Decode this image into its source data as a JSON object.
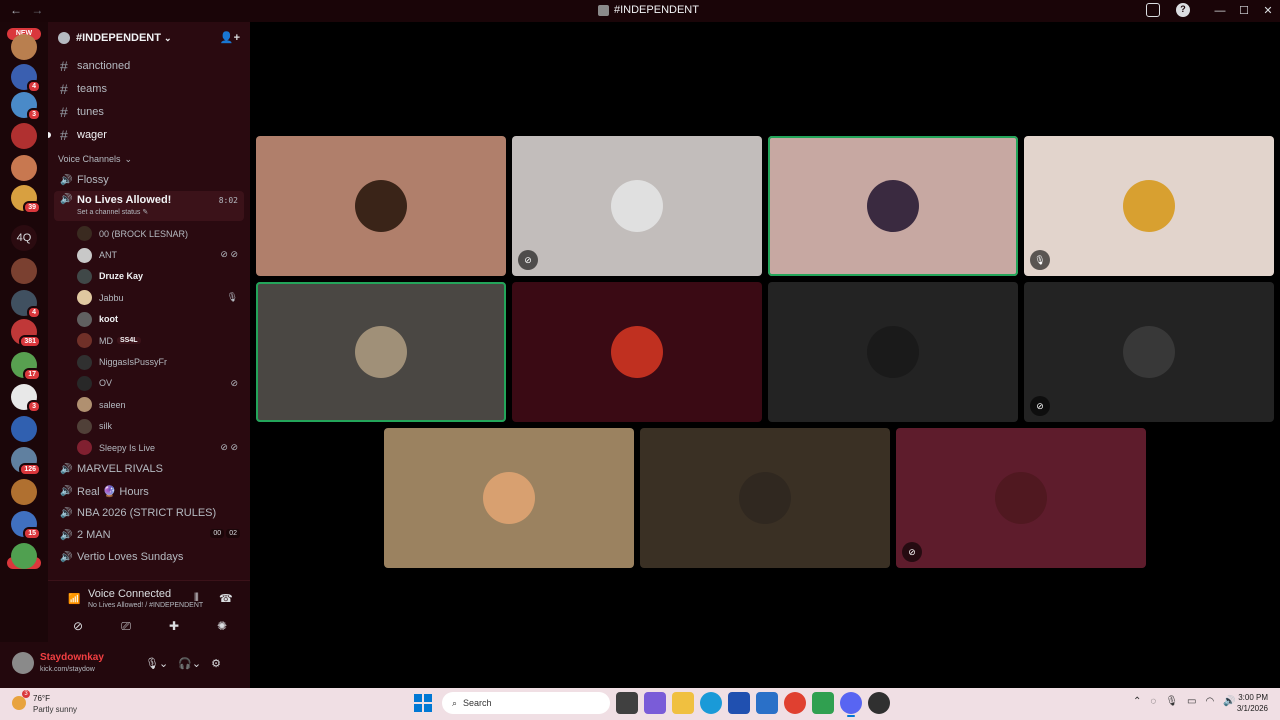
{
  "window": {
    "title": "#INDEPENDENT",
    "nav_back": "←",
    "nav_fwd": "→",
    "minimize": "—",
    "maximize": "☐",
    "close": "✕"
  },
  "guilds": {
    "new_top": "NEW",
    "new_bottom": "NEW",
    "items": [
      {
        "color": "#b97f4f",
        "badge": ""
      },
      {
        "color": "#3a5fb0",
        "badge": "4"
      },
      {
        "color": "#4a8ac8",
        "badge": "3"
      },
      {
        "color": "#b03030",
        "badge": ""
      },
      {
        "color": "#c87850",
        "badge": ""
      },
      {
        "color": "#d8a040",
        "badge": "39"
      },
      {
        "color": "#2b0b10",
        "badge": "",
        "text": "4Q"
      },
      {
        "color": "#7a4030",
        "badge": ""
      },
      {
        "color": "#405060",
        "badge": "4"
      },
      {
        "color": "#c03838",
        "badge": "381"
      },
      {
        "color": "#58a050",
        "badge": "17"
      },
      {
        "color": "#e8e8e8",
        "badge": "3"
      },
      {
        "color": "#3060b0",
        "badge": ""
      },
      {
        "color": "#6080a0",
        "badge": "126"
      },
      {
        "color": "#b07030",
        "badge": ""
      },
      {
        "color": "#4070c0",
        "badge": "15"
      },
      {
        "color": "#50a050",
        "badge": ""
      }
    ]
  },
  "server": {
    "name": "#INDEPENDENT",
    "chevron": "⌄",
    "invite_icon": "👤+"
  },
  "text_channels": [
    {
      "name": "sanctioned",
      "active": false
    },
    {
      "name": "teams",
      "active": false
    },
    {
      "name": "tunes",
      "active": false
    },
    {
      "name": "wager",
      "active": true
    }
  ],
  "voice_category": "Voice Channels",
  "voice_channels_top": [
    {
      "name": "Flossy"
    }
  ],
  "selected_voice": {
    "name": "No Lives Allowed!",
    "timer": "8:02",
    "status_prompt": "Set a channel status"
  },
  "members": [
    {
      "name": "00 (BROCK LESNAR)",
      "bold": false,
      "color": "#3a2a20",
      "icons": ""
    },
    {
      "name": "ANT",
      "bold": false,
      "color": "#c8c8c8",
      "icons": "⊘ ⊘"
    },
    {
      "name": "Druze Kay",
      "bold": true,
      "color": "#404848",
      "icons": ""
    },
    {
      "name": "Jabbu",
      "bold": false,
      "color": "#e0c8a0",
      "icons": "🎙"
    },
    {
      "name": "koot",
      "bold": true,
      "color": "#606060",
      "icons": ""
    },
    {
      "name": "MD",
      "bold": false,
      "color": "#703028",
      "icons": "",
      "tag": "SS4L"
    },
    {
      "name": "NiggasIsPussyFr",
      "bold": false,
      "color": "#303030",
      "icons": ""
    },
    {
      "name": "OV",
      "bold": false,
      "color": "#282828",
      "icons": "⊘"
    },
    {
      "name": "saleen",
      "bold": false,
      "color": "#b09070",
      "icons": ""
    },
    {
      "name": "silk",
      "bold": false,
      "color": "#504038",
      "icons": ""
    },
    {
      "name": "Sleepy Is Live",
      "bold": false,
      "color": "#802030",
      "icons": "⊘ ⊘"
    }
  ],
  "voice_channels_bottom": [
    {
      "name": "MARVEL RIVALS",
      "pills": []
    },
    {
      "name": "Real 🔮 Hours",
      "pills": []
    },
    {
      "name": "NBA 2026 (STRICT RULES)",
      "pills": []
    },
    {
      "name": "2 MAN",
      "pills": [
        "00",
        "02"
      ]
    },
    {
      "name": "Vertio Loves Sundays",
      "pills": []
    }
  ],
  "voice_connection": {
    "status": "Voice Connected",
    "location": "No Lives Allowed! / #INDEPENDENT"
  },
  "user": {
    "name": "Staydownkay",
    "status": "kick.com/staydow"
  },
  "tiles": [
    {
      "bg": "#b07f6b",
      "avatar": "#3a2418",
      "speaking": false,
      "icon": ""
    },
    {
      "bg": "#c2bdbb",
      "avatar": "#e0e0e0",
      "speaking": false,
      "icon": "⊘"
    },
    {
      "bg": "#c7a8a2",
      "avatar": "#3a2a40",
      "speaking": true,
      "icon": ""
    },
    {
      "bg": "#e2d4cc",
      "avatar": "#d8a030",
      "speaking": false,
      "icon": "🎙"
    },
    {
      "bg": "#4a4743",
      "avatar": "#a09078",
      "speaking": true,
      "icon": ""
    },
    {
      "bg": "#3a0a14",
      "avatar": "#c03020",
      "speaking": false,
      "icon": ""
    },
    {
      "bg": "#232323",
      "avatar": "#1a1a1a",
      "speaking": false,
      "icon": ""
    },
    {
      "bg": "#232323",
      "avatar": "#383838",
      "speaking": false,
      "icon": "⊘"
    },
    {
      "bg": "#9b8260",
      "avatar": "#d8a070",
      "speaking": false,
      "icon": ""
    },
    {
      "bg": "#3a3024",
      "avatar": "#302820",
      "speaking": false,
      "icon": ""
    },
    {
      "bg": "#5e1c2c",
      "avatar": "#501820",
      "speaking": false,
      "icon": "⊘"
    }
  ],
  "taskbar": {
    "temp": "76°F",
    "condition": "Partly sunny",
    "weather_badge": "3",
    "search_placeholder": "Search",
    "time": "3:00 PM",
    "date": "3/1/2026"
  }
}
